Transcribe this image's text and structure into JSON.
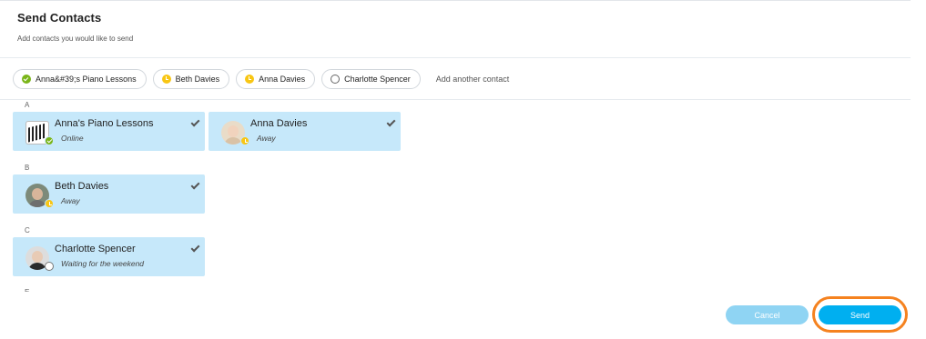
{
  "header": {
    "title": "Send Contacts",
    "subtitle": "Add contacts you would like to send"
  },
  "chips": [
    {
      "label": "Anna&#39;s Piano Lessons",
      "status": "online"
    },
    {
      "label": "Beth Davies",
      "status": "away"
    },
    {
      "label": "Anna Davies",
      "status": "away"
    },
    {
      "label": "Charlotte Spencer",
      "status": "offline"
    }
  ],
  "add_contact_placeholder": "Add another contact",
  "sections": [
    {
      "letter": "A",
      "contacts": [
        {
          "name": "Anna's Piano Lessons",
          "status_text": "Online",
          "status": "online",
          "selected": true
        },
        {
          "name": "Anna Davies",
          "status_text": "Away",
          "status": "away",
          "selected": true
        }
      ]
    },
    {
      "letter": "B",
      "contacts": [
        {
          "name": "Beth Davies",
          "status_text": "Away",
          "status": "away",
          "selected": true
        }
      ]
    },
    {
      "letter": "C",
      "contacts": [
        {
          "name": "Charlotte Spencer",
          "status_text": "Waiting for the weekend",
          "status": "offline",
          "selected": true
        }
      ]
    },
    {
      "letter": "E",
      "contacts": []
    }
  ],
  "buttons": {
    "cancel": "Cancel",
    "send": "Send"
  },
  "colors": {
    "accent": "#00aff0",
    "accent_disabled": "#8fd4f3",
    "card_selected": "#c6e8fa",
    "online": "#7ab519",
    "away": "#f8c614",
    "highlight_ring": "#f5821f"
  }
}
